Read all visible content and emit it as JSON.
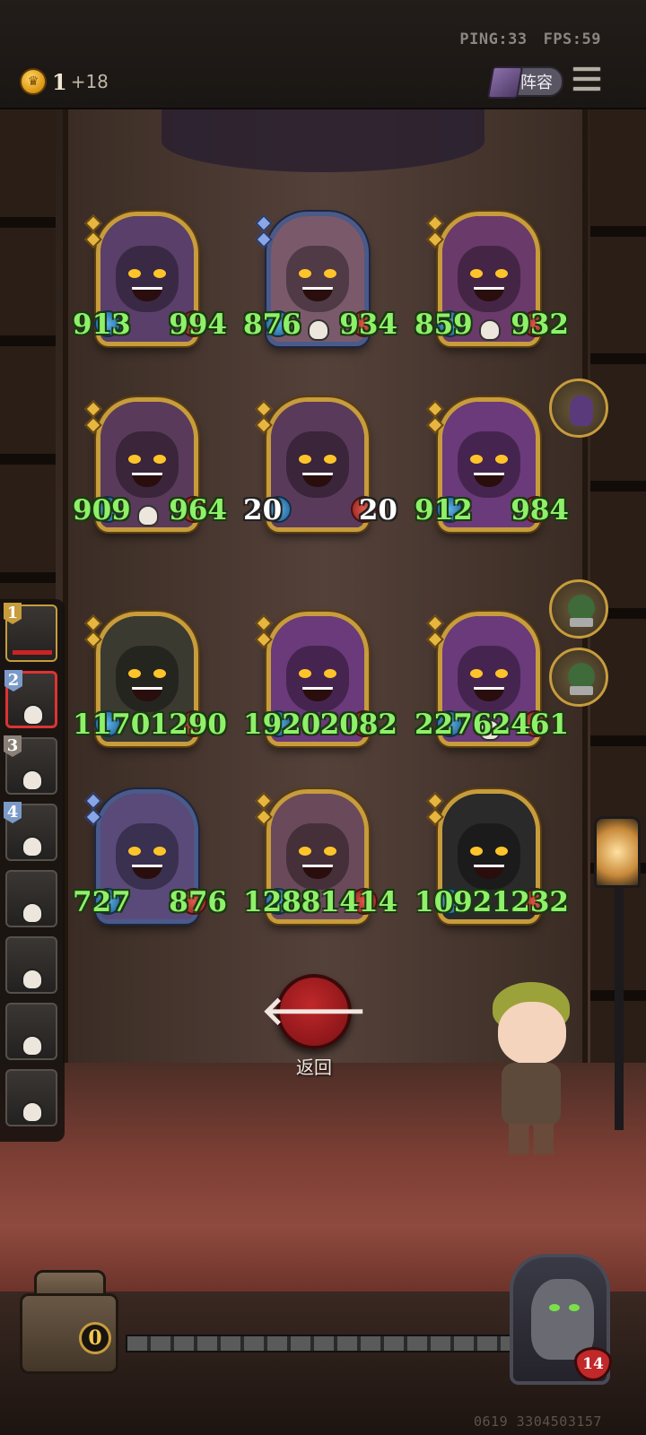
{
  "hud": {
    "ping": "PING:33",
    "fps": "FPS:59",
    "coins": "1",
    "coin_income": "+18",
    "lineup_label": "阵容"
  },
  "board": {
    "cards": [
      {
        "atk": "913",
        "hp": "994",
        "frame": "gold",
        "skull": false,
        "portrait": "wooden-mask",
        "color": "#5a3f6a"
      },
      {
        "atk": "876",
        "hp": "934",
        "frame": "blue",
        "skull": true,
        "portrait": "treant",
        "color": "#7a5a6a"
      },
      {
        "atk": "859",
        "hp": "932",
        "frame": "gold",
        "skull": true,
        "portrait": "pink-elf",
        "color": "#6a3a6a"
      },
      {
        "atk": "909",
        "hp": "964",
        "frame": "gold",
        "skull": true,
        "portrait": "pumpkin-beast",
        "color": "#5a3a5a"
      },
      {
        "atk": "20",
        "hp": "20",
        "frame": "gold",
        "skull": false,
        "portrait": "pumpkin-beast",
        "color": "#5a3a5a",
        "white_text": true
      },
      {
        "atk": "912",
        "hp": "984",
        "frame": "gold",
        "skull": false,
        "portrait": "cactus",
        "color": "#6a3a7a"
      },
      {
        "atk": "1170",
        "hp": "1290",
        "frame": "gold",
        "skull": false,
        "portrait": "pumpkin-beast",
        "color": "#3a3a30"
      },
      {
        "atk": "1920",
        "hp": "2082",
        "frame": "gold",
        "skull": false,
        "portrait": "cactus",
        "color": "#6a3a7a"
      },
      {
        "atk": "2276",
        "hp": "2461",
        "frame": "gold",
        "skull": true,
        "portrait": "wooden-mask",
        "color": "#6a3a7a"
      },
      {
        "atk": "727",
        "hp": "876",
        "frame": "blue",
        "skull": false,
        "portrait": "knight-girl",
        "color": "#5a4a7a"
      },
      {
        "atk": "1288",
        "hp": "1414",
        "frame": "gold",
        "skull": false,
        "portrait": "treant",
        "color": "#6a4a5a"
      },
      {
        "atk": "1092",
        "hp": "1232",
        "frame": "gold",
        "skull": false,
        "portrait": "winged-demon",
        "color": "#2a2a2a"
      }
    ]
  },
  "roster": {
    "slots": [
      {
        "num": "1",
        "state": "alive"
      },
      {
        "num": "2",
        "state": "selected"
      },
      {
        "num": "3",
        "state": "dead"
      },
      {
        "num": "4",
        "state": "dead"
      },
      {
        "num": "",
        "state": "dead"
      },
      {
        "num": "",
        "state": "dead"
      },
      {
        "num": "",
        "state": "dead"
      },
      {
        "num": "",
        "state": "dead"
      }
    ]
  },
  "back_button": {
    "label": "返回",
    "icon": "arrow-left-icon"
  },
  "chest": {
    "count": "0"
  },
  "player": {
    "health": "14"
  },
  "footer": {
    "uid": "0619 3304503157"
  }
}
